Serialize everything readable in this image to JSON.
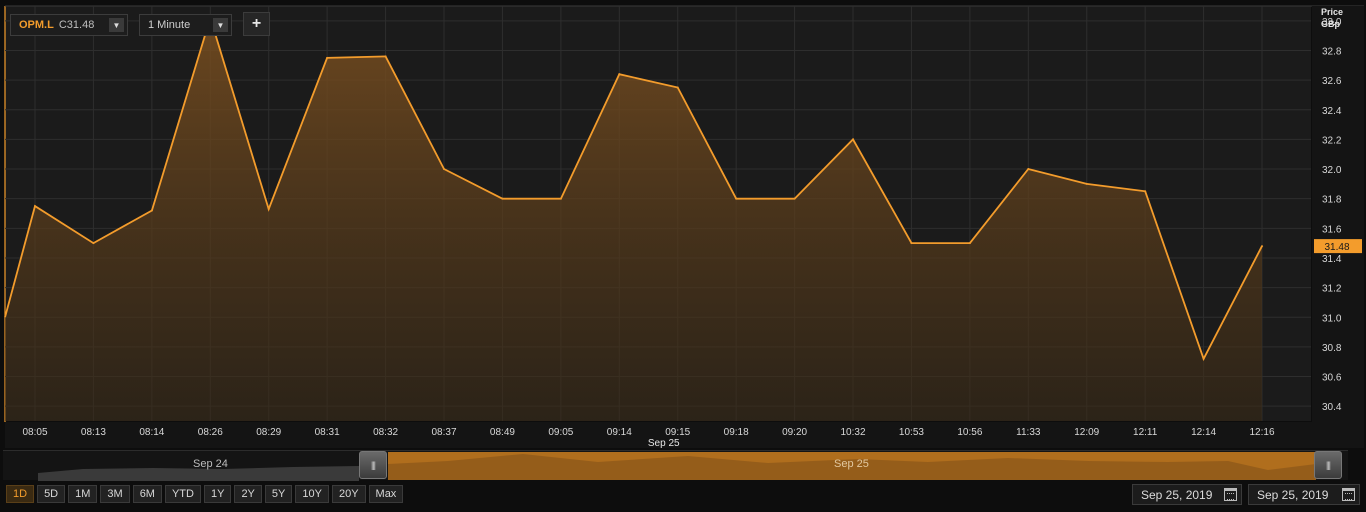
{
  "toolbar": {
    "symbol": "OPM.L",
    "close_prefix": "C",
    "close_value": "31.48",
    "interval": "1 Minute",
    "add_label": "+",
    "dropdown_glyph": "▼"
  },
  "axis_title": {
    "line1": "Price",
    "line2": "GBp"
  },
  "colors": {
    "line": "#f39c2c",
    "area_top": "#8a5a22",
    "plot_bg": "#1b1b1b",
    "grid": "#2e2e2e",
    "last_price_tag": "#f39c2c"
  },
  "chart_data": {
    "type": "area",
    "x": [
      "08:05",
      "08:13",
      "08:14",
      "08:26",
      "08:29",
      "08:31",
      "08:32",
      "08:37",
      "08:49",
      "09:05",
      "09:14",
      "09:15",
      "09:18",
      "09:20",
      "10:32",
      "10:53",
      "10:56",
      "11:33",
      "12:09",
      "12:11",
      "12:14",
      "12:16"
    ],
    "values": [
      31.75,
      31.5,
      31.72,
      33.02,
      31.73,
      32.75,
      32.76,
      32.0,
      31.8,
      31.8,
      32.64,
      32.55,
      31.8,
      31.8,
      32.2,
      31.5,
      31.5,
      32.0,
      31.9,
      31.85,
      30.72,
      31.48
    ],
    "start_value": 31.0,
    "last_value": "31.48",
    "ylim": [
      30.3,
      33.1
    ],
    "yticks": [
      "33.0",
      "32.8",
      "32.6",
      "32.4",
      "32.2",
      "32.0",
      "31.8",
      "31.6",
      "31.4",
      "31.2",
      "31.0",
      "30.8",
      "30.6",
      "30.4"
    ],
    "date_label": "Sep 25",
    "date_label_under": "09:15",
    "grid": true,
    "legend": "none"
  },
  "navigator": {
    "prev_label": "Sep 24",
    "current_label": "Sep 25",
    "handle_glyph": "|||"
  },
  "range_buttons": [
    {
      "label": "1D",
      "active": true
    },
    {
      "label": "5D"
    },
    {
      "label": "1M"
    },
    {
      "label": "3M"
    },
    {
      "label": "6M"
    },
    {
      "label": "YTD"
    },
    {
      "label": "1Y"
    },
    {
      "label": "2Y"
    },
    {
      "label": "5Y"
    },
    {
      "label": "10Y"
    },
    {
      "label": "20Y"
    },
    {
      "label": "Max"
    }
  ],
  "date_range": {
    "from": "Sep 25, 2019",
    "to": "Sep 25, 2019"
  }
}
